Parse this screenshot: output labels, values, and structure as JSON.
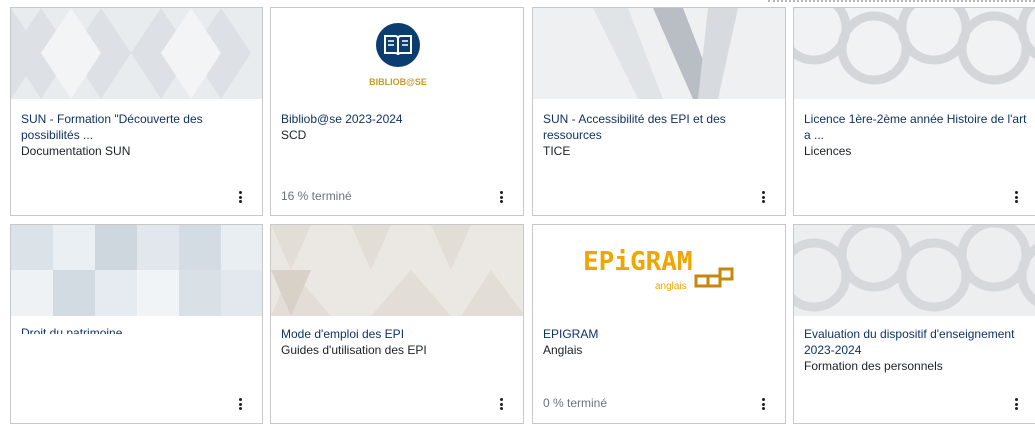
{
  "cards": [
    {
      "title": "SUN - Formation \"Découverte des possibilités ...",
      "category": "Documentation SUN",
      "progress": ""
    },
    {
      "title": "Bibliob@se 2023-2024",
      "category": "SCD",
      "progress": "16 % terminé",
      "logo_text": "BIBLIOB@SE"
    },
    {
      "title": "SUN - Accessibilité des EPI et des ressources",
      "category": "TICE",
      "progress": ""
    },
    {
      "title": "Licence 1ère-2ème année Histoire de l'art a ...",
      "category": "Licences",
      "progress": ""
    },
    {
      "title": "Droit du patrimoine",
      "category": "",
      "progress": ""
    },
    {
      "title": "Mode d'emploi des EPI",
      "category": "Guides d'utilisation des EPI",
      "progress": ""
    },
    {
      "title": "EPIGRAM",
      "category": "Anglais",
      "progress": "0 % terminé",
      "logo_text": "EPiGRAM",
      "logo_sub": "anglais"
    },
    {
      "title": "Evaluation du dispositif d'enseignement 2023-2024",
      "category": "Formation des personnels",
      "progress": ""
    }
  ],
  "colors": {
    "title": "#0f3264",
    "accent_logo": "#0b3d6e",
    "epigram": "#f0a500"
  }
}
